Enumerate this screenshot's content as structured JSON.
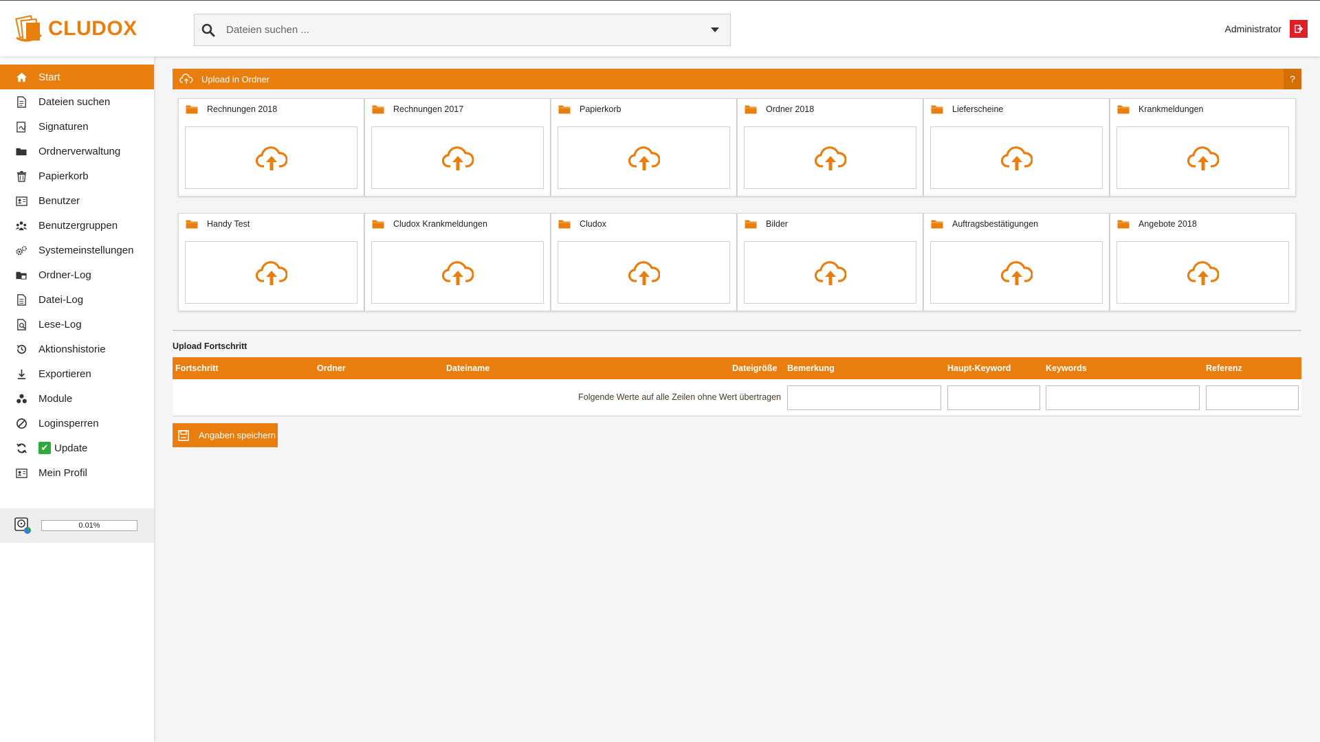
{
  "app": {
    "logo_text": "CLUDOX",
    "brand_color": "#e87e0d",
    "accent_red": "#e11d25"
  },
  "search": {
    "placeholder": "Dateien suchen ...",
    "icon": "search-icon"
  },
  "user": {
    "name": "Administrator",
    "logout_icon": "logout-icon"
  },
  "sidebar": {
    "items": [
      {
        "label": "Start",
        "icon": "home-icon",
        "active": true
      },
      {
        "label": "Dateien suchen",
        "icon": "document-search-icon"
      },
      {
        "label": "Signaturen",
        "icon": "signature-icon"
      },
      {
        "label": "Ordnerverwaltung",
        "icon": "folder-icon"
      },
      {
        "label": "Papierkorb",
        "icon": "trash-icon"
      },
      {
        "label": "Benutzer",
        "icon": "user-card-icon"
      },
      {
        "label": "Benutzergruppen",
        "icon": "user-group-icon"
      },
      {
        "label": "Systemeinstellungen",
        "icon": "gears-icon"
      },
      {
        "label": "Ordner-Log",
        "icon": "folder-log-icon"
      },
      {
        "label": "Datei-Log",
        "icon": "file-log-icon"
      },
      {
        "label": "Lese-Log",
        "icon": "read-log-icon"
      },
      {
        "label": "Aktionshistorie",
        "icon": "history-icon"
      },
      {
        "label": "Exportieren",
        "icon": "download-icon"
      },
      {
        "label": "Module",
        "icon": "modules-icon"
      },
      {
        "label": "Loginsperren",
        "icon": "block-icon"
      },
      {
        "label": "Update",
        "icon": "refresh-icon",
        "badge": "check-icon"
      },
      {
        "label": "Mein Profil",
        "icon": "profile-card-icon"
      }
    ],
    "disk_usage": {
      "text": "0.01%",
      "fraction": 0.0001
    }
  },
  "upload": {
    "title": "Upload in Ordner",
    "help": "?",
    "folders": [
      "Rechnungen 2018",
      "Rechnungen 2017",
      "Papierkorb",
      "Ordner 2018",
      "Lieferscheine",
      "Krankmeldungen",
      "Handy Test",
      "Cludox Krankmeldungen",
      "Cludox",
      "Bilder",
      "Auftragsbestätigungen",
      "Angebote 2018"
    ]
  },
  "progress": {
    "title": "Upload Fortschritt",
    "columns": {
      "fortschritt": "Fortschritt",
      "ordner": "Ordner",
      "dateiname": "Dateiname",
      "dateigroesse": "Dateigröße",
      "bemerkung": "Bemerkung",
      "haupt_keyword": "Haupt-Keyword",
      "keywords": "Keywords",
      "referenz": "Referenz"
    },
    "apply_label": "Folgende Werte auf alle Zeilen ohne Wert übertragen",
    "save_label": "Angaben speichern"
  }
}
